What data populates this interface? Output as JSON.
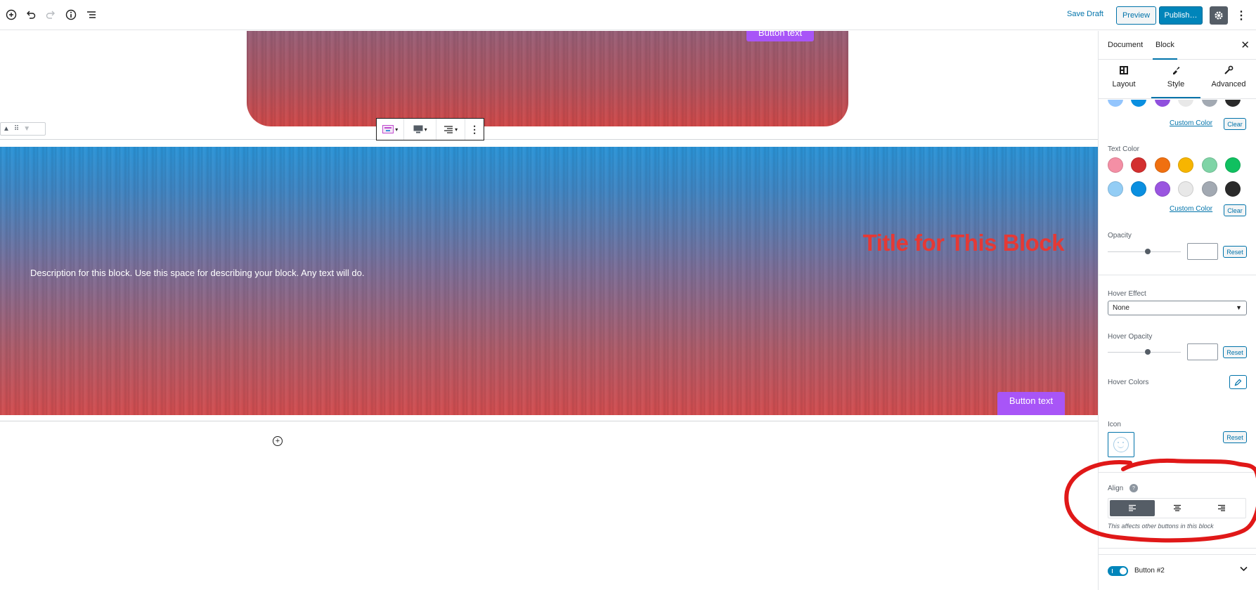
{
  "toolbar": {
    "add_icon": "plus-circle-icon",
    "undo_icon": "undo-icon",
    "redo_icon": "redo-icon",
    "info_icon": "info-icon",
    "outline_icon": "list-icon",
    "save_draft": "Save Draft",
    "preview": "Preview",
    "publish": "Publish…",
    "settings_icon": "gear-icon",
    "more_icon": "vertical-ellipsis-icon"
  },
  "canvas": {
    "top_block_button": "Button text",
    "main_title": "Title for This Block",
    "main_description": "Description for this block. Use this space for describing your block. Any text will do.",
    "main_buttons": [
      "Button text",
      "Button text"
    ],
    "colors": {
      "title": "#e53935",
      "button": "#a855f7"
    }
  },
  "sidebar": {
    "tabs": [
      "Document",
      "Block"
    ],
    "active_tab": "Block",
    "subtabs": [
      "Layout",
      "Style",
      "Advanced"
    ],
    "active_subtab": "Style",
    "bg_partial_row": [
      "#93c5fd",
      "#0a8fe0",
      "#9050dd",
      "#e8e8e8",
      "#a2a9b2",
      "#2a2a2a"
    ],
    "custom_color_1": "Custom Color",
    "clear_1": "Clear",
    "text_color_label": "Text Color",
    "text_colors_row1": [
      "#f48fa5",
      "#d32f2f",
      "#f07010",
      "#f7b500",
      "#7fd4a6",
      "#10c060"
    ],
    "text_colors_row2": [
      "#93cdf5",
      "#0a8fe0",
      "#9a55e0",
      "#e8e8e8",
      "#a2a9b2",
      "#2a2a2a"
    ],
    "custom_color_2": "Custom Color",
    "clear_2": "Clear",
    "opacity_label": "Opacity",
    "reset_1": "Reset",
    "hover_effect_label": "Hover Effect",
    "hover_effect_value": "None",
    "hover_opacity_label": "Hover Opacity",
    "reset_2": "Reset",
    "hover_colors_label": "Hover Colors",
    "icon_label": "Icon",
    "reset_3": "Reset",
    "align_label": "Align",
    "align_options": [
      "align-left-icon",
      "align-center-icon",
      "align-right-icon"
    ],
    "align_selected": "left",
    "align_note": "This affects other buttons in this block",
    "button2_label": "Button #2",
    "button2_enabled": true
  },
  "annotation_color": "#e01818"
}
